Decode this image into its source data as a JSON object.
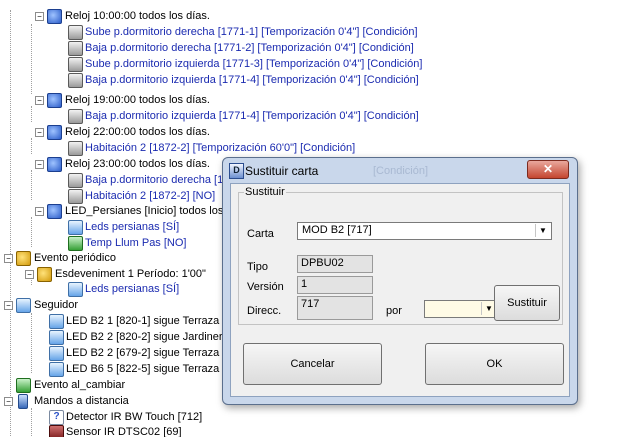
{
  "tree": {
    "items": [
      {
        "text": "Reloj 10:00:00 todos los días.",
        "color": "#000000"
      },
      {
        "text": "Sube p.dormitorio derecha [1771-1] [Temporización 0'4\"] [Condición]",
        "color": "#1b2bb0"
      },
      {
        "text": "Baja p.dormitorio derecha [1771-2] [Temporización 0'4\"] [Condición]",
        "color": "#1b2bb0"
      },
      {
        "text": "Sube p.dormitorio izquierda [1771-3] [Temporización 0'4\"] [Condición]",
        "color": "#1b2bb0"
      },
      {
        "text": "Baja p.dormitorio izquierda [1771-4] [Temporización 0'4\"] [Condición]",
        "color": "#1b2bb0"
      },
      {
        "text": "Reloj 19:00:00 todos los días.",
        "color": "#000000"
      },
      {
        "text": "Baja p.dormitorio izquierda [1771-4] [Temporización 0'4\"] [Condición]",
        "color": "#1b2bb0"
      },
      {
        "text": "Reloj 22:00:00 todos los días.",
        "color": "#000000"
      },
      {
        "text": "Habitación 2 [1872-2] [Temporización 60'0\"] [Condición]",
        "color": "#1b2bb0"
      },
      {
        "text": "Reloj 23:00:00 todos los días.",
        "color": "#000000"
      },
      {
        "text": "Baja p.dormitorio derecha [1",
        "color": "#1b2bb0"
      },
      {
        "text": "Habitación 2 [1872-2] [NO]",
        "color": "#1b2bb0"
      },
      {
        "text": "LED_Persianes  [Inicio] todos los",
        "color": "#000000"
      },
      {
        "text": "Leds persianas [SÍ]",
        "color": "#1b2bb0"
      },
      {
        "text": "Temp Llum Pas [NO]",
        "color": "#1b2bb0"
      },
      {
        "text": "Evento periódico",
        "color": "#000000"
      },
      {
        "text": "Esdeveniment 1 Período: 1'00\"",
        "color": "#000000"
      },
      {
        "text": "Leds persianas [SÍ]",
        "color": "#1b2bb0"
      },
      {
        "text": "Seguidor",
        "color": "#000000"
      },
      {
        "text": "LED B2 1 [820-1] sigue Terraza",
        "color": "#000000"
      },
      {
        "text": "LED B2 2 [820-2] sigue Jardinera",
        "color": "#000000"
      },
      {
        "text": "LED B2 2 [679-2] sigue Terraza",
        "color": "#000000"
      },
      {
        "text": "LED B6 5 [822-5] sigue Terraza",
        "color": "#000000"
      },
      {
        "text": "Evento al_cambiar",
        "color": "#000000"
      },
      {
        "text": "Mandos a distancia",
        "color": "#000000"
      },
      {
        "text": "Detector IR BW Touch [712]",
        "color": "#000000"
      },
      {
        "text": "Sensor IR DTSC02 [69]",
        "color": "#000000"
      }
    ],
    "background_ghost_text": "[Condición]"
  },
  "dialog": {
    "title": "Sustituir carta",
    "close_glyph": "✕",
    "group_label": "Sustituir",
    "carta_label": "Carta",
    "carta_value": "MOD B2 [717]",
    "tipo_label": "Tipo",
    "tipo_value": "DPBU02",
    "version_label": "Versión",
    "version_value": "1",
    "direcc_label": "Direcc.",
    "direcc_value": "717",
    "por_label": "por",
    "por_value": "",
    "sustituir_button": "Sustituir",
    "cancel_button": "Cancelar",
    "ok_button": "OK",
    "arrow_glyph": "▼"
  }
}
